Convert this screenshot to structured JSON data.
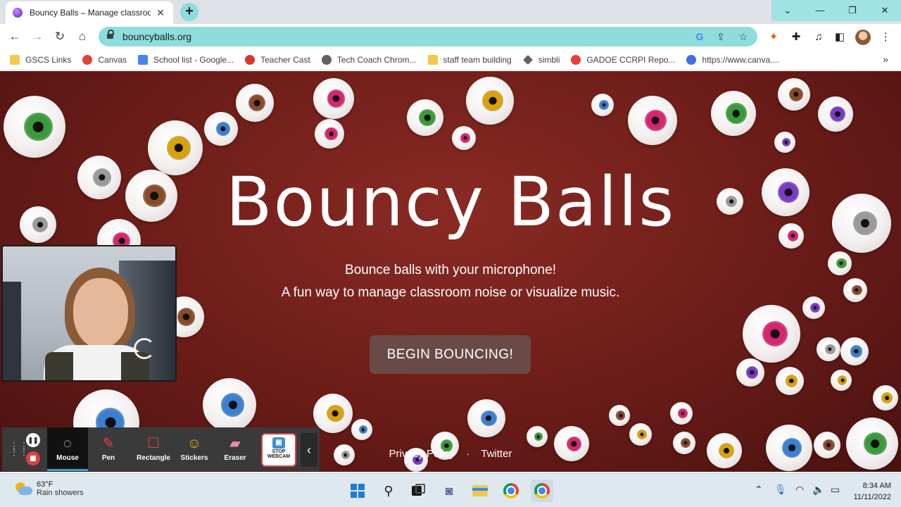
{
  "browser": {
    "tab_title": "Bouncy Balls – Manage classroom",
    "tab_close": "✕",
    "new_tab": "+",
    "url": "bouncyballs.org",
    "window_controls": [
      "⌄",
      "—",
      "❐",
      "✕"
    ]
  },
  "bookmarks": [
    {
      "label": "GSCS Links",
      "color": "#f2c94c"
    },
    {
      "label": "Canvas",
      "color": "#e2413a"
    },
    {
      "label": "School list - Google...",
      "color": "#4285f4"
    },
    {
      "label": "Teacher Cast",
      "color": "#d9352a"
    },
    {
      "label": "Tech Coach Chrom...",
      "color": "#5f6368"
    },
    {
      "label": "staff team building",
      "color": "#f2c94c"
    },
    {
      "label": "simbli",
      "color": "#5f6368"
    },
    {
      "label": "GADOE CCRPI Repo...",
      "color": "#e2413a"
    },
    {
      "label": "https://www.canva....",
      "color": "#3f6fe0"
    }
  ],
  "bookmarks_more": "»",
  "page": {
    "title": "Bouncy Balls",
    "tagline_1": "Bounce balls with your microphone!",
    "tagline_2": "A fun way to manage classroom noise or visualize music.",
    "cta": "BEGIN BOUNCING!",
    "footer_privacy": "Privacy Policy",
    "footer_sep": "·",
    "footer_twitter": "Twitter"
  },
  "iris_colors": {
    "green": "#3a9a3a",
    "pink": "#d8246e",
    "yellow": "#d8a20a",
    "blue": "#3a7fd0",
    "brown": "#8a4a2a",
    "purple": "#7a3ac8",
    "gray": "#9a9a9a"
  },
  "annotation_toolbar": {
    "tools": [
      "Mouse",
      "Pen",
      "Rectangle",
      "Stickers",
      "Eraser"
    ],
    "webcam_button": "STOP WEBCAM",
    "active_tool": "Mouse"
  },
  "taskbar": {
    "temperature": "63°F",
    "condition": "Rain showers",
    "time": "8:34 AM",
    "date": "11/11/2022"
  }
}
